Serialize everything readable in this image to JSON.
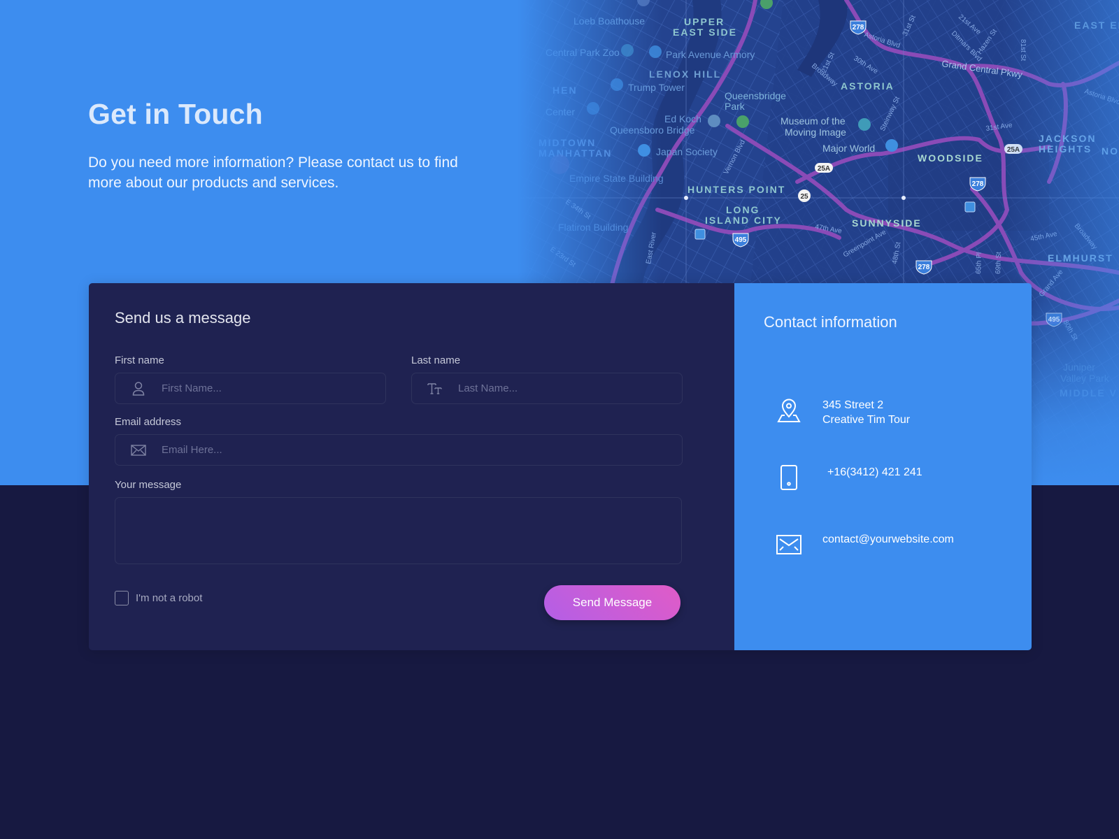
{
  "hero": {
    "title": "Get in Touch",
    "subtitle": "Do you need more information? Please contact us to find more about our products and services."
  },
  "map": {
    "labels": {
      "upper_east_side_1": "UPPER",
      "upper_east_side_2": "EAST SIDE",
      "lenox_hill": "LENOX HILL",
      "astoria": "ASTORIA",
      "woodside": "WOODSIDE",
      "hunters_point": "HUNTERS POINT",
      "long_island_city_1": "LONG",
      "long_island_city_2": "ISLAND CITY",
      "sunnyside": "SUNNYSIDE",
      "jackson_heights_1": "JACKSON",
      "jackson_heights_2": "HEIGHTS",
      "elmhurst": "ELMHURST",
      "east_elmhurst": "EAST EL",
      "midtown_1": "MIDTOWN",
      "midtown_2": "MANHATTAN",
      "middle_village": "MIDDLE V",
      "north": "NOR",
      "hen": "HEN"
    },
    "pois": {
      "boathouse": "Loeb Boathouse",
      "zoo": "Central Park Zoo",
      "armory": "Park Avenue Armory",
      "trump": "Trump Tower",
      "center": "Center",
      "queensbridge_1": "Queensbridge",
      "queensbridge_2": "Park",
      "edkoch_1": "Ed Koch",
      "edkoch_2": "Queensboro Bridge",
      "museum_1": "Museum of the",
      "museum_2": "Moving Image",
      "major_world": "Major World",
      "japan_society": "Japan Society",
      "empire": "Empire State Building",
      "flatiron": "Flatiron Building",
      "juniper_1": "Juniper",
      "juniper_2": "Valley Park"
    },
    "streets": {
      "grand_central": "Grand Central Pkwy",
      "astoria_blvd": "Astoria Blvd",
      "astoria_blvd_2": "Astoria Blvd",
      "ave30": "30th Ave",
      "st21": "21st St",
      "st31": "31st St",
      "ave21": "21st Ave",
      "ditmars": "Ditmars Blvd",
      "hazen": "Hazen St",
      "st81": "81st St",
      "ave31": "31st Ave",
      "broadway": "Broadway",
      "broadway2": "Broadway",
      "steinway": "Steinway St",
      "vernon": "Vernon Blvd",
      "e34": "E 34th St",
      "e23": "E 23rd St",
      "east_river": "East River",
      "ave47": "47th Ave",
      "greenpoint": "Greenpoint Ave",
      "st48": "48th St",
      "pl65": "65th Pl",
      "st69": "69th St",
      "ave45": "45th Ave",
      "grand_ave": "Grand Ave",
      "st80": "80th St"
    },
    "shields": {
      "i278_a": "278",
      "i278_b": "278",
      "i278_c": "278",
      "i495_a": "495",
      "i495_b": "495",
      "r25a_a": "25A",
      "r25a_b": "25A",
      "r25": "25"
    }
  },
  "form": {
    "title": "Send us a message",
    "first_name": {
      "label": "First name",
      "placeholder": "First Name...",
      "value": ""
    },
    "last_name": {
      "label": "Last name",
      "placeholder": "Last Name...",
      "value": ""
    },
    "email": {
      "label": "Email address",
      "placeholder": "Email Here...",
      "value": ""
    },
    "message": {
      "label": "Your message",
      "value": ""
    },
    "robot_label": "I'm not a robot",
    "robot_checked": false,
    "submit_label": "Send Message"
  },
  "contact": {
    "title": "Contact information",
    "address_line1": "345 Street 2",
    "address_line2": "Creative Tim Tour",
    "phone": "+16(3412) 421 241",
    "email": "contact@yourwebsite.com"
  },
  "colors": {
    "primary": "#3d8def",
    "panel": "#1f2251",
    "background": "#171941",
    "accent_start": "#b35fe6",
    "accent_end": "#e05bc7"
  }
}
